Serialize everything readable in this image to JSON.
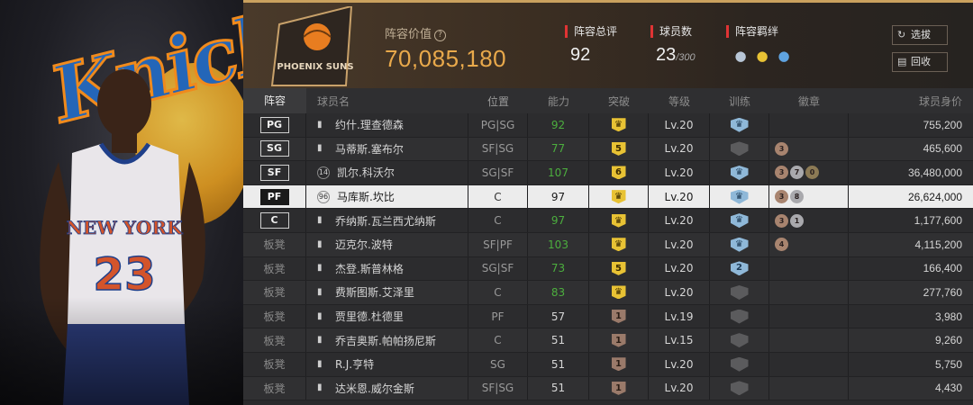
{
  "header": {
    "value_label": "阵容价值",
    "value": "70,085,180",
    "team_logo_text": "PHOENIX SUNS",
    "stats": [
      {
        "label": "阵容总评",
        "value": "92"
      },
      {
        "label": "球员数",
        "value": "23",
        "max": "/300"
      },
      {
        "label": "阵容羁绊"
      }
    ],
    "buttons": {
      "select": "选拔",
      "recycle": "回收"
    }
  },
  "columns": [
    "阵容",
    "球员名",
    "位置",
    "能力",
    "突破",
    "等级",
    "训练",
    "徽章",
    "球员身价"
  ],
  "rows": [
    {
      "slot": "PG",
      "name": "约什.理查德森",
      "role": "PG|SG",
      "ovr": "92",
      "ovr_green": true,
      "brk": "crown",
      "brk_type": "gold",
      "lv": "Lv.20",
      "train": "crown",
      "train_type": "blue",
      "badges": [],
      "price": "755,200"
    },
    {
      "slot": "SG",
      "name": "马蒂斯.塞布尔",
      "role": "SF|SG",
      "ovr": "77",
      "ovr_green": true,
      "brk": "5",
      "brk_type": "gold",
      "lv": "Lv.20",
      "train": "",
      "train_type": "grey",
      "badges": [
        {
          "t": "bronze",
          "v": "3"
        }
      ],
      "price": "465,600"
    },
    {
      "slot": "SF",
      "name": "凯尔.科沃尔",
      "role": "SG|SF",
      "ovr": "107",
      "ovr_green": true,
      "brk": "6",
      "brk_type": "gold",
      "lv": "Lv.20",
      "train": "crown",
      "train_type": "blue",
      "badges": [
        {
          "t": "bronze",
          "v": "3"
        },
        {
          "t": "silver",
          "v": "7"
        },
        {
          "t": "gold",
          "v": "0"
        }
      ],
      "price": "36,480,000",
      "num_icon": "14"
    },
    {
      "slot": "PF",
      "name": "马库斯.坎比",
      "role": "C",
      "ovr": "97",
      "ovr_green": false,
      "brk": "crown",
      "brk_type": "gold",
      "lv": "Lv.20",
      "train": "crown",
      "train_type": "blue",
      "badges": [
        {
          "t": "bronze",
          "v": "3"
        },
        {
          "t": "silver",
          "v": "8"
        }
      ],
      "price": "26,624,000",
      "selected": true,
      "num_icon": "96"
    },
    {
      "slot": "C",
      "name": "乔纳斯.瓦兰西尤纳斯",
      "role": "C",
      "ovr": "97",
      "ovr_green": true,
      "brk": "crown",
      "brk_type": "gold",
      "lv": "Lv.20",
      "train": "crown",
      "train_type": "blue",
      "badges": [
        {
          "t": "bronze",
          "v": "3"
        },
        {
          "t": "silver",
          "v": "1"
        }
      ],
      "price": "1,177,600"
    },
    {
      "slot": "板凳",
      "name": "迈克尔.波特",
      "role": "SF|PF",
      "ovr": "103",
      "ovr_green": true,
      "brk": "crown",
      "brk_type": "gold",
      "lv": "Lv.20",
      "train": "crown",
      "train_type": "blue",
      "badges": [
        {
          "t": "bronze",
          "v": "4"
        }
      ],
      "price": "4,115,200"
    },
    {
      "slot": "板凳",
      "name": "杰登.斯普林格",
      "role": "SG|SF",
      "ovr": "73",
      "ovr_green": true,
      "brk": "5",
      "brk_type": "gold",
      "lv": "Lv.20",
      "train": "2",
      "train_type": "blue",
      "badges": [],
      "price": "166,400"
    },
    {
      "slot": "板凳",
      "name": "费斯图斯.艾泽里",
      "role": "C",
      "ovr": "83",
      "ovr_green": true,
      "brk": "crown",
      "brk_type": "gold",
      "lv": "Lv.20",
      "train": "",
      "train_type": "grey",
      "badges": [],
      "price": "277,760"
    },
    {
      "slot": "板凳",
      "name": "贾里德.杜德里",
      "role": "PF",
      "ovr": "57",
      "ovr_green": false,
      "brk": "1",
      "brk_type": "brown",
      "lv": "Lv.19",
      "train": "",
      "train_type": "grey",
      "badges": [],
      "price": "3,980"
    },
    {
      "slot": "板凳",
      "name": "乔吉奥斯.帕帕扬尼斯",
      "role": "C",
      "ovr": "51",
      "ovr_green": false,
      "brk": "1",
      "brk_type": "brown",
      "lv": "Lv.15",
      "train": "",
      "train_type": "grey",
      "badges": [],
      "price": "9,260"
    },
    {
      "slot": "板凳",
      "name": "R.J.亨特",
      "role": "SG",
      "ovr": "51",
      "ovr_green": false,
      "brk": "1",
      "brk_type": "brown",
      "lv": "Lv.20",
      "train": "",
      "train_type": "grey",
      "badges": [],
      "price": "5,750"
    },
    {
      "slot": "板凳",
      "name": "达米恩.威尔金斯",
      "role": "SF|SG",
      "ovr": "51",
      "ovr_green": false,
      "brk": "1",
      "brk_type": "brown",
      "lv": "Lv.20",
      "train": "",
      "train_type": "grey",
      "badges": [],
      "price": "4,430"
    }
  ],
  "left_panel": {
    "jersey_team": "NEW YORK",
    "jersey_number": "23",
    "logo_word": "Knicks"
  },
  "colors": {
    "accent_value": "#e9a94b",
    "green": "#4cae3e",
    "red_marker": "#e03434",
    "gold_breakthrough": "#e8c234",
    "train_blue": "#8fb8d8"
  }
}
